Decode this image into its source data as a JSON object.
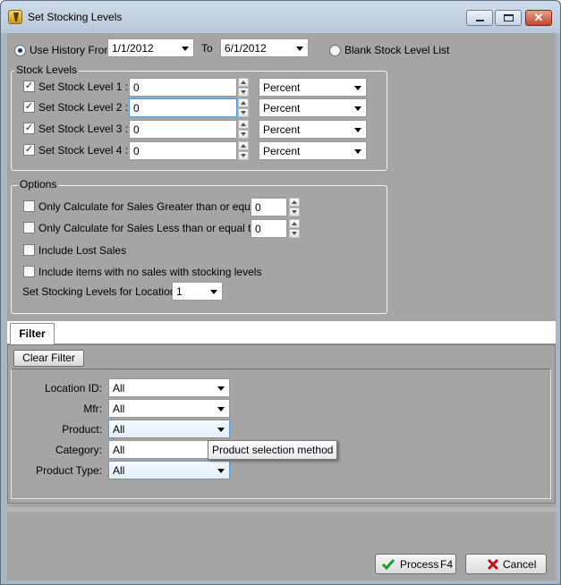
{
  "window": {
    "title": "Set Stocking Levels",
    "close_glyph": "✕"
  },
  "history": {
    "use_history_label": "Use History From:",
    "from_date": "1/1/2012",
    "to_label": "To",
    "to_date": "6/1/2012",
    "blank_list_label": "Blank Stock Level List",
    "selected_mode": "use_history"
  },
  "stock_levels": {
    "group_title": "Stock Levels",
    "rows": [
      {
        "label": "Set Stock Level 1 :",
        "checked": true,
        "value": "0",
        "unit": "Percent"
      },
      {
        "label": "Set Stock Level 2 :",
        "checked": true,
        "value": "0",
        "unit": "Percent"
      },
      {
        "label": "Set Stock Level 3 :",
        "checked": true,
        "value": "0",
        "unit": "Percent"
      },
      {
        "label": "Set Stock Level 4 :",
        "checked": true,
        "value": "0",
        "unit": "Percent"
      }
    ]
  },
  "options": {
    "group_title": "Options",
    "greater_label": "Only Calculate for Sales Greater than or equal to:",
    "greater_value": "0",
    "less_label": "Only Calculate for Sales Less than or equal to:",
    "less_value": "0",
    "lost_sales_label": "Include Lost Sales",
    "no_sales_label": "Include items with no sales with stocking levels",
    "location_label": "Set Stocking Levels for Location:",
    "location_value": "1"
  },
  "filter": {
    "tab_label": "Filter",
    "clear_button": "Clear Filter",
    "fields": [
      {
        "label": "Location ID:",
        "value": "All"
      },
      {
        "label": "Mfr:",
        "value": "All"
      },
      {
        "label": "Product:",
        "value": "All"
      },
      {
        "label": "Category:",
        "value": "All"
      },
      {
        "label": "Product Type:",
        "value": "All"
      }
    ],
    "tooltip": "Product selection method"
  },
  "footer": {
    "process_label": "Process",
    "process_shortcut": "F4",
    "cancel_label": "Cancel"
  },
  "colors": {
    "process_icon": "#1f9a2e",
    "cancel_icon": "#c0141a"
  }
}
